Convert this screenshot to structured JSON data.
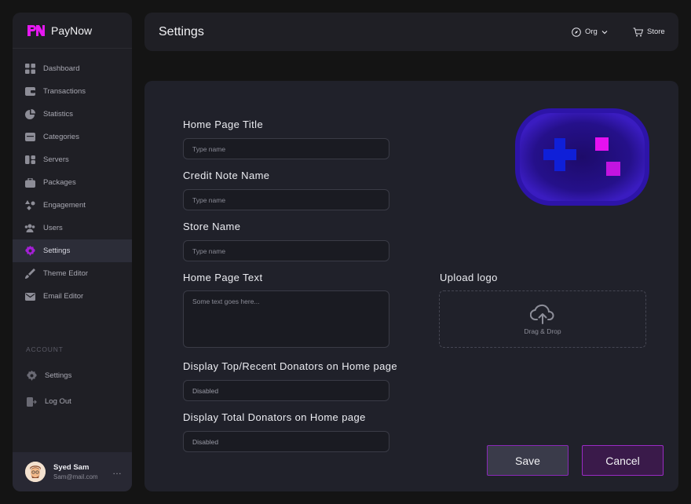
{
  "brand": {
    "name": "PayNow",
    "accent": "#e518f0"
  },
  "sidebar": {
    "items": [
      {
        "label": "Dashboard",
        "icon": "grid-icon"
      },
      {
        "label": "Transactions",
        "icon": "wallet-icon"
      },
      {
        "label": "Statistics",
        "icon": "pie-chart-icon"
      },
      {
        "label": "Categories",
        "icon": "folder-icon"
      },
      {
        "label": "Servers",
        "icon": "server-icon"
      },
      {
        "label": "Packages",
        "icon": "briefcase-icon"
      },
      {
        "label": "Engagement",
        "icon": "shapes-icon"
      },
      {
        "label": "Users",
        "icon": "users-icon"
      },
      {
        "label": "Settings",
        "icon": "gear-icon",
        "active": true
      },
      {
        "label": "Theme Editor",
        "icon": "brush-icon"
      },
      {
        "label": "Email Editor",
        "icon": "mail-icon"
      }
    ],
    "account_label": "ACCOUNT",
    "account_items": [
      {
        "label": "Settings",
        "icon": "gear-icon"
      },
      {
        "label": "Log Out",
        "icon": "logout-icon"
      }
    ]
  },
  "profile": {
    "name": "Syed Sam",
    "email": "Sam@mail.com",
    "more": "…"
  },
  "header": {
    "title": "Settings",
    "org_label": "Org",
    "store_label": "Store"
  },
  "form": {
    "home_title": {
      "label": "Home Page Title",
      "placeholder": "Type name"
    },
    "credit_note": {
      "label": "Credit Note Name",
      "placeholder": "Type name"
    },
    "store_name": {
      "label": "Store Name",
      "placeholder": "Type name"
    },
    "home_text": {
      "label": "Home Page Text",
      "placeholder": "Some text goes here..."
    },
    "upload": {
      "label": "Upload logo",
      "hint": "Drag & Drop"
    },
    "top_donators": {
      "label": "Display Top/Recent Donators on Home page",
      "value": "Disabled"
    },
    "total_donators": {
      "label": "Display Total Donators on Home page",
      "value": "Disabled"
    }
  },
  "actions": {
    "save": "Save",
    "cancel": "Cancel"
  },
  "colors": {
    "bg": "#141414",
    "card": "#20212a",
    "accent": "#9a2bc4"
  }
}
